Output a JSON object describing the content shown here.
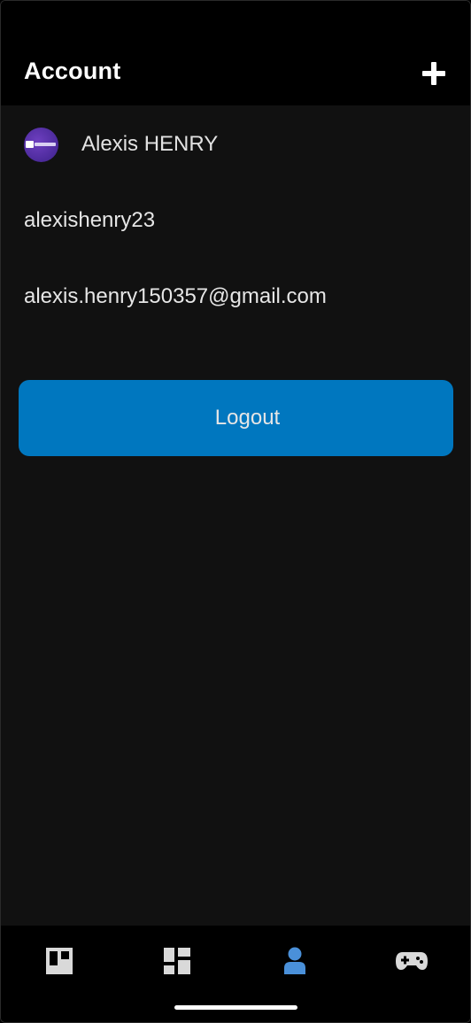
{
  "header": {
    "title": "Account",
    "add_icon": "plus-icon"
  },
  "account": {
    "display_name": "Alexis HENRY",
    "username": "alexishenry23",
    "email": "alexis.henry150357@gmail.com",
    "avatar_icon": "avatar-logo-icon"
  },
  "actions": {
    "logout_label": "Logout"
  },
  "bottom_nav": {
    "items": [
      {
        "icon": "boards-icon",
        "active": false
      },
      {
        "icon": "dashboard-icon",
        "active": false
      },
      {
        "icon": "account-icon",
        "active": true
      },
      {
        "icon": "gamepad-icon",
        "active": false
      }
    ]
  },
  "colors": {
    "background": "#111111",
    "header_background": "#000000",
    "accent": "#0077bf",
    "active_nav": "#4a90d9",
    "inactive_nav": "#d9d9d9"
  }
}
